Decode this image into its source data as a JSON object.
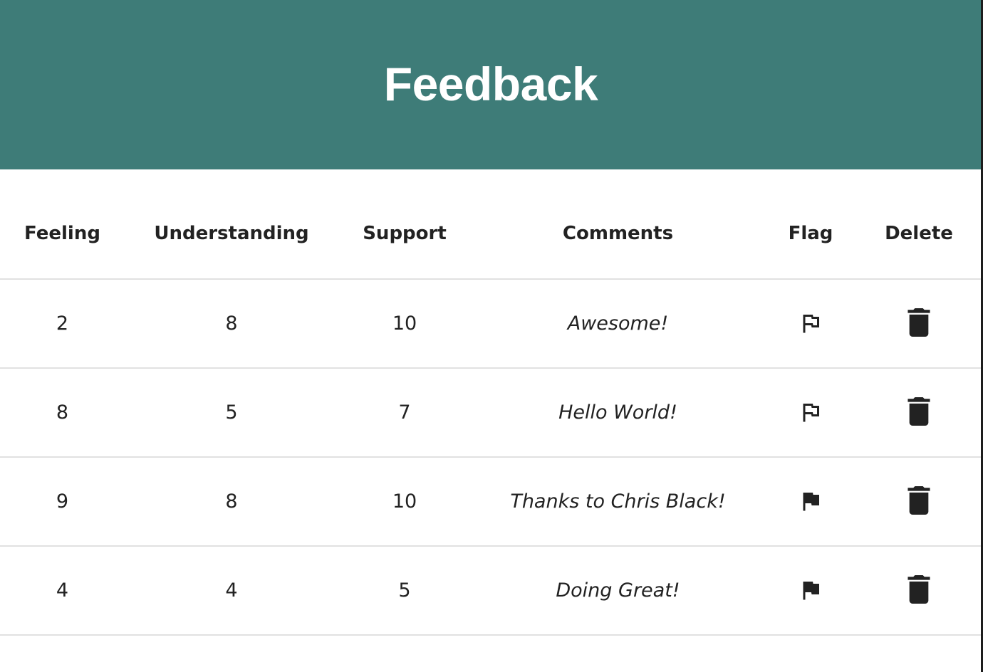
{
  "header": {
    "title": "Feedback"
  },
  "table": {
    "columns": [
      "Feeling",
      "Understanding",
      "Support",
      "Comments",
      "Flag",
      "Delete"
    ],
    "rows": [
      {
        "feeling": "2",
        "understanding": "8",
        "support": "10",
        "comment": "Awesome!",
        "flagged": false
      },
      {
        "feeling": "8",
        "understanding": "5",
        "support": "7",
        "comment": "Hello World!",
        "flagged": false
      },
      {
        "feeling": "9",
        "understanding": "8",
        "support": "10",
        "comment": "Thanks to Chris Black!",
        "flagged": true
      },
      {
        "feeling": "4",
        "understanding": "4",
        "support": "5",
        "comment": "Doing Great!",
        "flagged": true
      }
    ]
  },
  "colors": {
    "header_background": "#3e7c78",
    "header_text": "#ffffff",
    "text": "#222222",
    "row_divider": "#e1e1e1"
  },
  "icons": {
    "flag_outlined": "flag-outline-icon",
    "flag_filled": "flag-filled-icon",
    "delete": "trash-icon"
  }
}
